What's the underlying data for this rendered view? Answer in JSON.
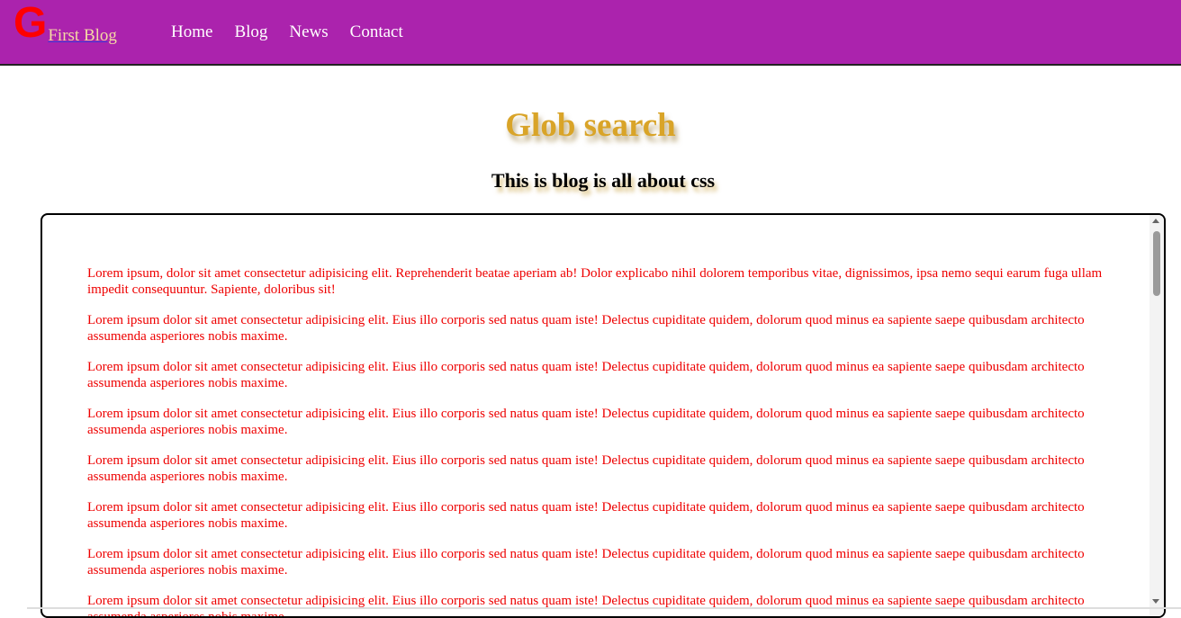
{
  "header": {
    "logo_letter": "G",
    "logo_text": "First Blog",
    "nav": [
      {
        "label": "Home"
      },
      {
        "label": "Blog"
      },
      {
        "label": "News"
      },
      {
        "label": "Contact"
      }
    ]
  },
  "main": {
    "title": "Glob search",
    "subtitle": "This is blog is all about css",
    "paragraphs": [
      "Lorem ipsum, dolor sit amet consectetur adipisicing elit. Reprehenderit beatae aperiam ab! Dolor explicabo nihil dolorem temporibus vitae, dignissimos, ipsa nemo sequi earum fuga ullam impedit consequuntur. Sapiente, doloribus sit!",
      "Lorem ipsum dolor sit amet consectetur adipisicing elit. Eius illo corporis sed natus quam iste! Delectus cupiditate quidem, dolorum quod minus ea sapiente saepe quibusdam architecto assumenda asperiores nobis maxime.",
      "Lorem ipsum dolor sit amet consectetur adipisicing elit. Eius illo corporis sed natus quam iste! Delectus cupiditate quidem, dolorum quod minus ea sapiente saepe quibusdam architecto assumenda asperiores nobis maxime.",
      "Lorem ipsum dolor sit amet consectetur adipisicing elit. Eius illo corporis sed natus quam iste! Delectus cupiditate quidem, dolorum quod minus ea sapiente saepe quibusdam architecto assumenda asperiores nobis maxime.",
      "Lorem ipsum dolor sit amet consectetur adipisicing elit. Eius illo corporis sed natus quam iste! Delectus cupiditate quidem, dolorum quod minus ea sapiente saepe quibusdam architecto assumenda asperiores nobis maxime.",
      "Lorem ipsum dolor sit amet consectetur adipisicing elit. Eius illo corporis sed natus quam iste! Delectus cupiditate quidem, dolorum quod minus ea sapiente saepe quibusdam architecto assumenda asperiores nobis maxime.",
      "Lorem ipsum dolor sit amet consectetur adipisicing elit. Eius illo corporis sed natus quam iste! Delectus cupiditate quidem, dolorum quod minus ea sapiente saepe quibusdam architecto assumenda asperiores nobis maxime.",
      "Lorem ipsum dolor sit amet consectetur adipisicing elit. Eius illo corporis sed natus quam iste! Delectus cupiditate quidem, dolorum quod minus ea sapiente saepe quibusdam architecto assumenda asperiores nobis maxime."
    ]
  },
  "colors": {
    "navbar_bg": "#ab23ad",
    "logo_g": "#ff0000",
    "title": "#d9a428",
    "paragraph_text": "#ee0000"
  }
}
